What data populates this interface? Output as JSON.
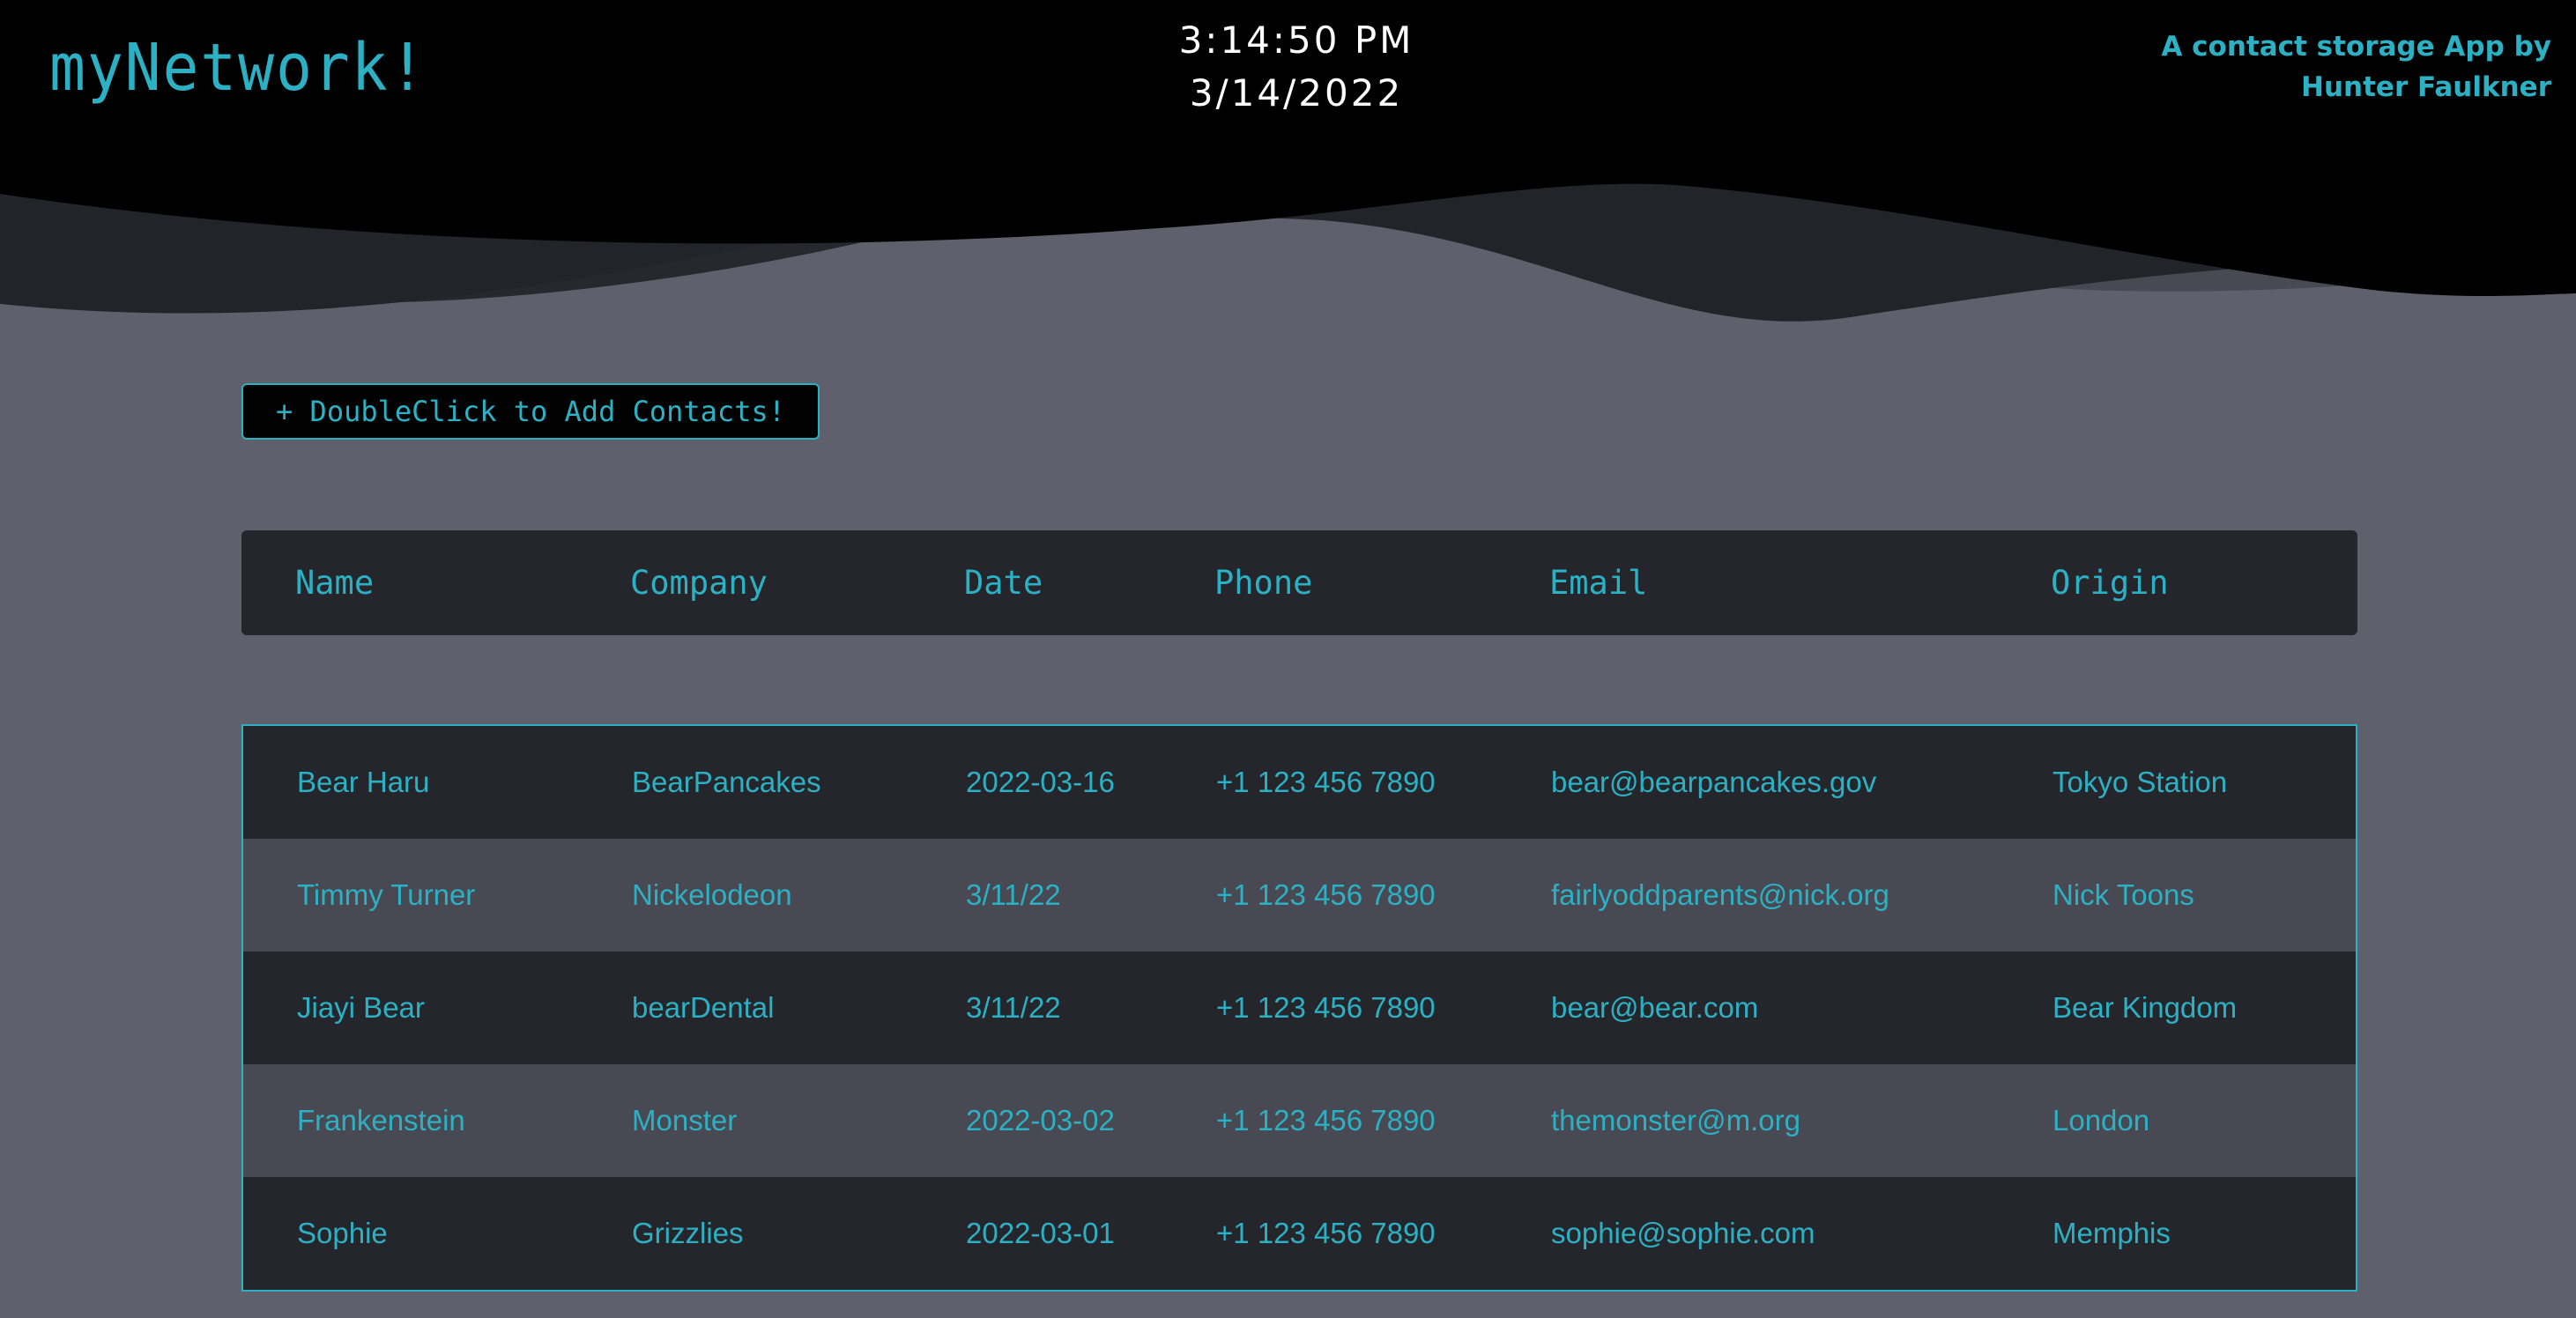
{
  "app": {
    "logo": "myNetwork!",
    "time": "3:14:50 PM",
    "date": "3/14/2022",
    "tagline_line1": "A contact storage App by",
    "tagline_line2": "Hunter Faulkner"
  },
  "actions": {
    "add_label": "+ DoubleClick to Add Contacts!"
  },
  "table": {
    "columns": [
      "Name",
      "Company",
      "Date",
      "Phone",
      "Email",
      "Origin"
    ],
    "rows": [
      {
        "name": "Bear Haru",
        "company": "BearPancakes",
        "date": "2022-03-16",
        "phone": "+1 123 456 7890",
        "email": "bear@bearpancakes.gov",
        "origin": "Tokyo Station"
      },
      {
        "name": "Timmy Turner",
        "company": "Nickelodeon",
        "date": "3/11/22",
        "phone": "+1 123 456 7890",
        "email": "fairlyoddparents@nick.org",
        "origin": "Nick Toons"
      },
      {
        "name": "Jiayi Bear",
        "company": "bearDental",
        "date": "3/11/22",
        "phone": "+1 123 456 7890",
        "email": "bear@bear.com",
        "origin": "Bear Kingdom"
      },
      {
        "name": "Frankenstein",
        "company": "Monster",
        "date": "2022-03-02",
        "phone": "+1 123 456 7890",
        "email": "themonster@m.org",
        "origin": "London"
      },
      {
        "name": "Sophie",
        "company": "Grizzlies",
        "date": "2022-03-01",
        "phone": "+1 123 456 7890",
        "email": "sophie@sophie.com",
        "origin": "Memphis"
      }
    ]
  },
  "colors": {
    "accent": "#2cb1c4",
    "header_bg": "#000000",
    "page_bg": "#5f606b",
    "row_dark": "#25262b",
    "row_light": "#484952"
  }
}
